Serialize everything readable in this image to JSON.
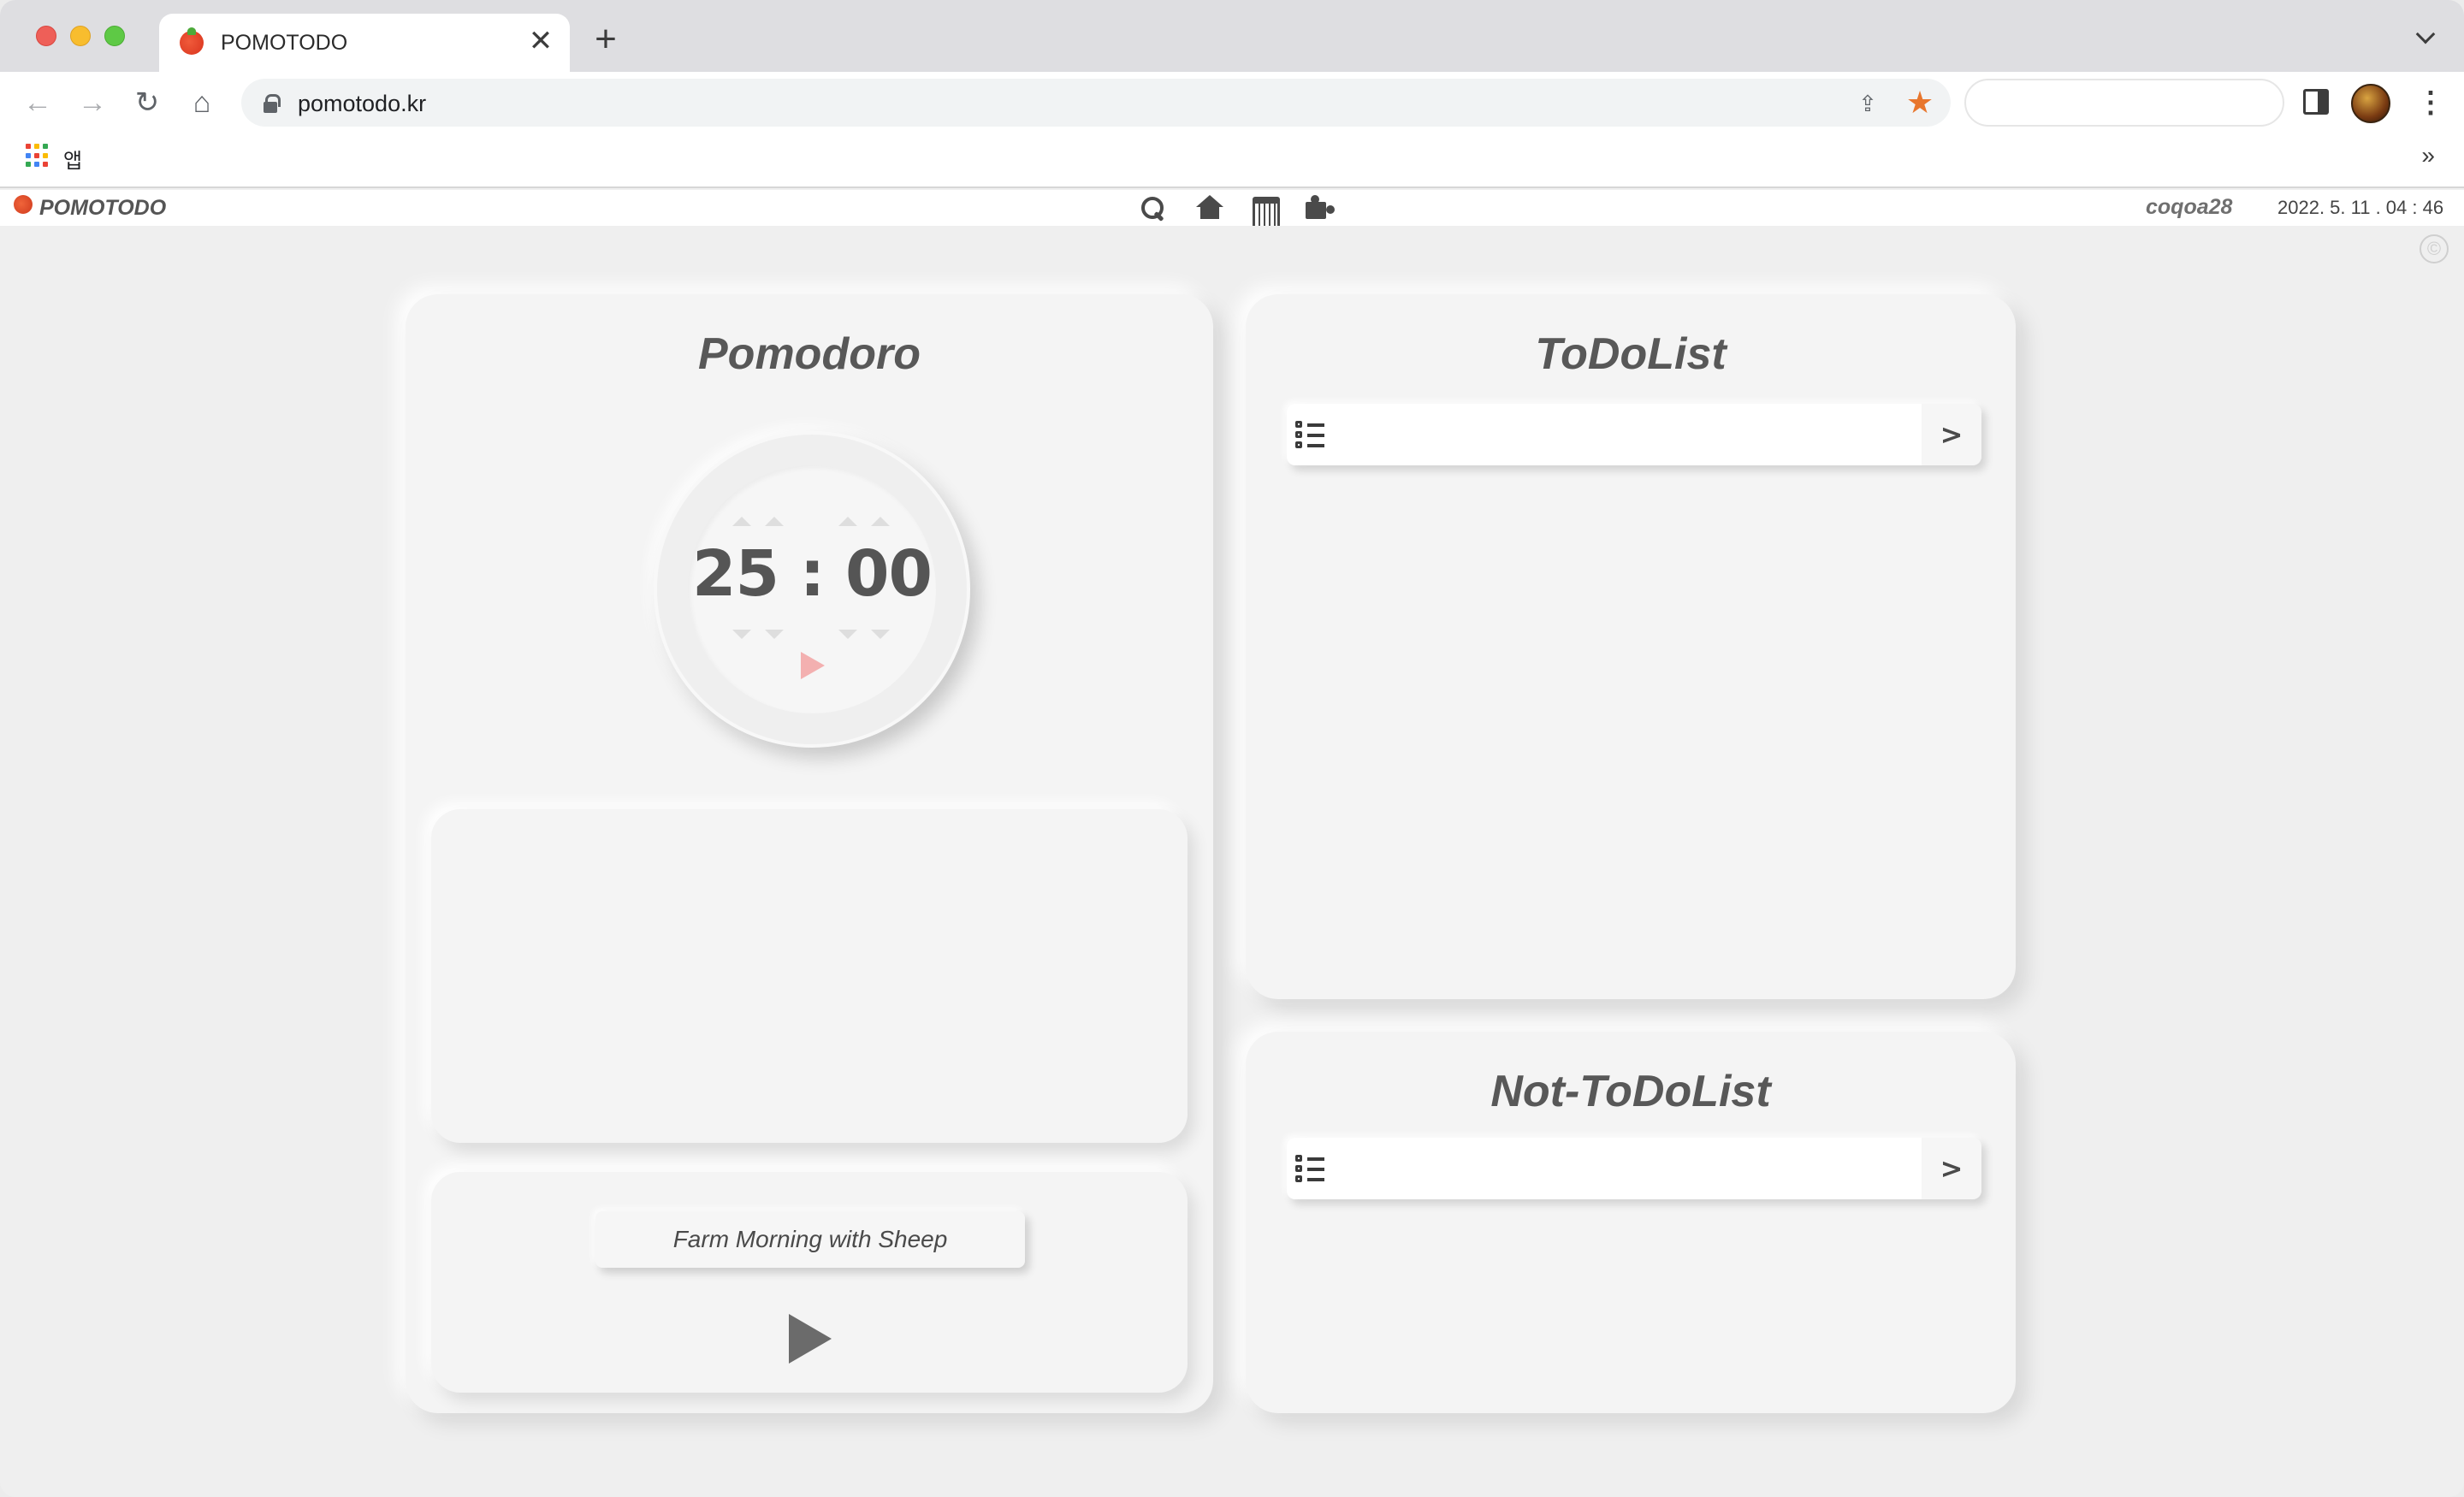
{
  "browser": {
    "tab_title": "POMOTODO",
    "tab_close": "✕",
    "new_tab": "+",
    "url": "pomotodo.kr",
    "bookmarks_label": "앱",
    "bookmarks_more": "»",
    "back_glyph": "←",
    "forward_glyph": "→",
    "reload_glyph": "↻",
    "home_glyph": "⌂",
    "share_glyph": "⇪",
    "star_glyph": "★",
    "menu_glyph": "⋮",
    "star_color": "#e8762d"
  },
  "app": {
    "logo": "POMOTODO",
    "username": "coqoa28",
    "datetime": "2022. 5. 11 . 04 : 46",
    "copyright": "©",
    "nav_icons": [
      "search-icon",
      "home-icon",
      "calendar-icon",
      "puzzle-icon"
    ]
  },
  "pomodoro": {
    "title": "Pomodoro",
    "timer": "25 : 00",
    "play_color": "#f3b0b0"
  },
  "music": {
    "track": "Farm Morning with Sheep"
  },
  "todo": {
    "title": "ToDoList",
    "input_value": "",
    "submit": ">"
  },
  "nottodo": {
    "title": "Not-ToDoList",
    "input_value": "",
    "submit": ">"
  }
}
